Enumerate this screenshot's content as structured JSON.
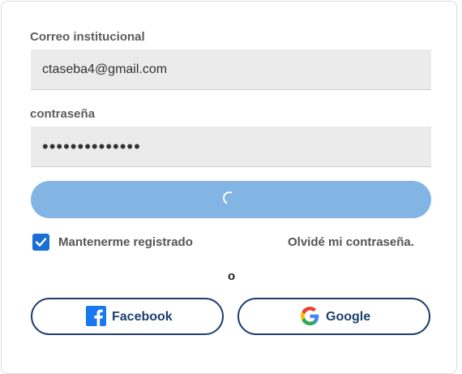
{
  "form": {
    "email_label": "Correo institucional",
    "email_value": "ctaseba4@gmail.com",
    "password_label": "contraseña",
    "password_value": "••••••••••••••",
    "remember_label": "Mantenerme registrado",
    "remember_checked": true,
    "forgot_label": "Olvidé mi contraseña.",
    "separator": "o"
  },
  "social": {
    "facebook_label": "Facebook",
    "google_label": "Google"
  },
  "colors": {
    "submit_bg": "#82b4e4",
    "social_border": "#1d3f6e",
    "checkbox": "#1a6fd4",
    "facebook": "#1877f2"
  },
  "icons": [
    "loading-spinner-icon",
    "checkmark-icon",
    "facebook-icon",
    "google-icon"
  ]
}
